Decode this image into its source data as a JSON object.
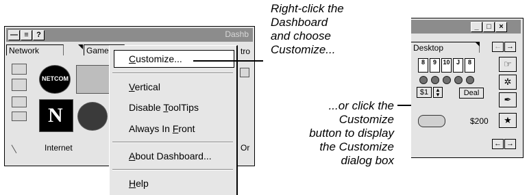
{
  "left_window": {
    "title": "Dashb",
    "tabs": {
      "network": "Network",
      "games": "Game"
    },
    "panel_label": "Internet",
    "right_tab_fragment": "tro",
    "right_panel_fragment": "Or"
  },
  "context_menu": {
    "items": [
      {
        "pre": "",
        "u": "C",
        "post": "ustomize..."
      },
      {
        "pre": "",
        "u": "V",
        "post": "ertical"
      },
      {
        "pre": "Disable ",
        "u": "T",
        "post": "oolTips"
      },
      {
        "pre": "Always In ",
        "u": "F",
        "post": "ront"
      },
      {
        "pre": "",
        "u": "A",
        "post": "bout Dashboard..."
      },
      {
        "pre": "",
        "u": "H",
        "post": "elp"
      }
    ]
  },
  "callouts": {
    "top": [
      "Right-click the",
      "Dashboard",
      "and choose",
      "Customize..."
    ],
    "bottom": [
      "...or click the",
      "Customize",
      "button to display",
      "the Customize",
      "dialog box"
    ]
  },
  "right_window": {
    "tab_label": "Desktop",
    "cards": [
      "8",
      "9",
      "10",
      "J",
      "8"
    ],
    "bet_value": "$1",
    "deal_label": "Deal",
    "money": "$200"
  }
}
